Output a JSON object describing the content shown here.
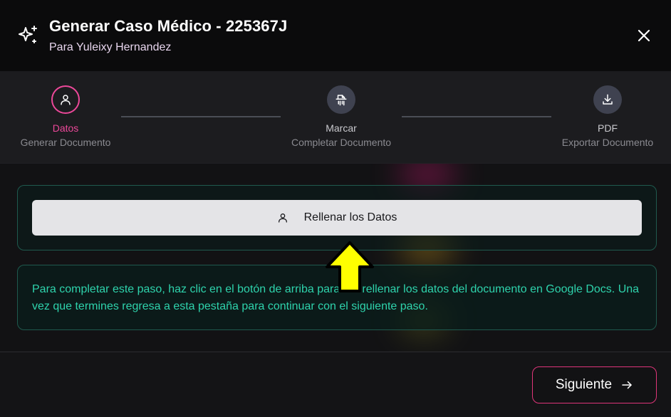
{
  "header": {
    "title": "Generar Caso Médico - 225367J",
    "subtitle": "Para Yuleixy Hernandez",
    "icon": "sparkles-icon",
    "close_icon": "close-icon"
  },
  "stepper": {
    "steps": [
      {
        "label": "Datos",
        "sublabel": "Generar Documento",
        "icon": "user-icon",
        "state": "active"
      },
      {
        "label": "Marcar",
        "sublabel": "Completar Documento",
        "icon": "shredder-icon",
        "state": "pending"
      },
      {
        "label": "PDF",
        "sublabel": "Exportar Documento",
        "icon": "download-icon",
        "state": "pending"
      }
    ]
  },
  "main": {
    "fill_button_label": "Rellenar los Datos",
    "fill_button_icon": "user-icon",
    "info_text": "Para completar este paso, haz clic en el botón de arriba para ir a rellenar los datos del documento en Google Docs. Una vez que termines regresa a esta pestaña para continuar con el siguiente paso."
  },
  "footer": {
    "next_label": "Siguiente",
    "next_icon": "arrow-right-icon"
  },
  "colors": {
    "accent": "#e0357a",
    "active_step": "#ec4899",
    "info_text": "#2ed3ac",
    "card_border": "#1f5a4e",
    "annotation_arrow": "#ffff00"
  }
}
